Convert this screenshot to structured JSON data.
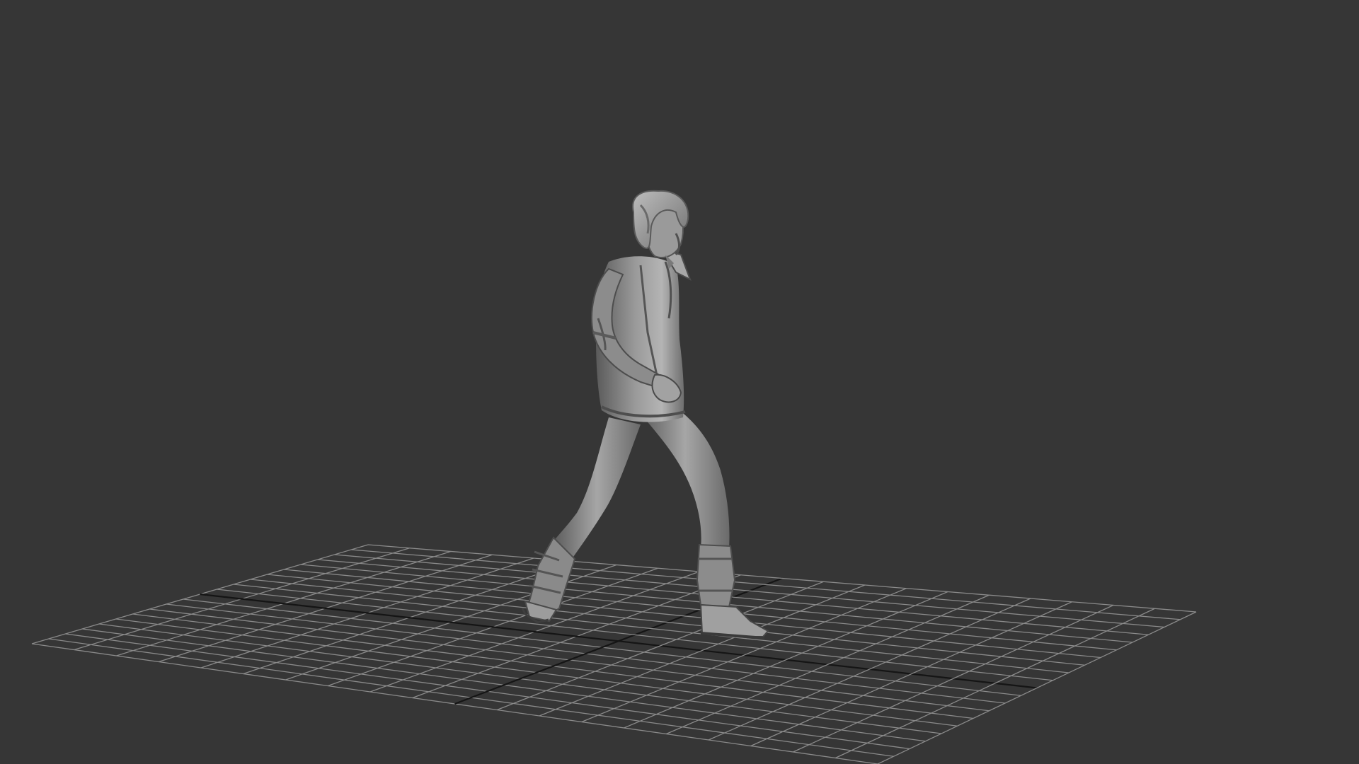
{
  "viewport": {
    "background_color": "#363636",
    "grid": {
      "visible": true,
      "line_color": "#8a8a8a",
      "axis_color": "#151515",
      "divisions_per_side": 20
    },
    "model": {
      "description_icon": "walking-character-model",
      "shading": "clay-gray",
      "base_color": "#8e8e8e",
      "shadow_color": "#4a4a4a",
      "highlight_color": "#c4c4c4"
    }
  }
}
